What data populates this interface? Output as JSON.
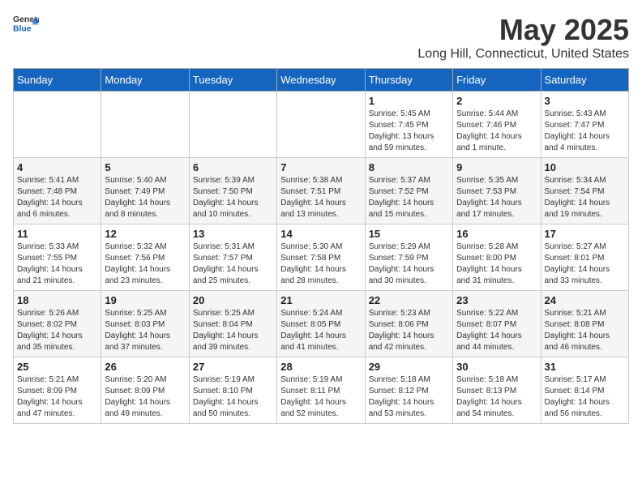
{
  "header": {
    "logo_general": "General",
    "logo_blue": "Blue",
    "title": "May 2025",
    "subtitle": "Long Hill, Connecticut, United States"
  },
  "days_of_week": [
    "Sunday",
    "Monday",
    "Tuesday",
    "Wednesday",
    "Thursday",
    "Friday",
    "Saturday"
  ],
  "weeks": [
    {
      "row_style": "row-odd",
      "days": [
        {
          "number": "",
          "info": ""
        },
        {
          "number": "",
          "info": ""
        },
        {
          "number": "",
          "info": ""
        },
        {
          "number": "",
          "info": ""
        },
        {
          "number": "1",
          "info": "Sunrise: 5:45 AM\nSunset: 7:45 PM\nDaylight: 13 hours\nand 59 minutes."
        },
        {
          "number": "2",
          "info": "Sunrise: 5:44 AM\nSunset: 7:46 PM\nDaylight: 14 hours\nand 1 minute."
        },
        {
          "number": "3",
          "info": "Sunrise: 5:43 AM\nSunset: 7:47 PM\nDaylight: 14 hours\nand 4 minutes."
        }
      ]
    },
    {
      "row_style": "row-even",
      "days": [
        {
          "number": "4",
          "info": "Sunrise: 5:41 AM\nSunset: 7:48 PM\nDaylight: 14 hours\nand 6 minutes."
        },
        {
          "number": "5",
          "info": "Sunrise: 5:40 AM\nSunset: 7:49 PM\nDaylight: 14 hours\nand 8 minutes."
        },
        {
          "number": "6",
          "info": "Sunrise: 5:39 AM\nSunset: 7:50 PM\nDaylight: 14 hours\nand 10 minutes."
        },
        {
          "number": "7",
          "info": "Sunrise: 5:38 AM\nSunset: 7:51 PM\nDaylight: 14 hours\nand 13 minutes."
        },
        {
          "number": "8",
          "info": "Sunrise: 5:37 AM\nSunset: 7:52 PM\nDaylight: 14 hours\nand 15 minutes."
        },
        {
          "number": "9",
          "info": "Sunrise: 5:35 AM\nSunset: 7:53 PM\nDaylight: 14 hours\nand 17 minutes."
        },
        {
          "number": "10",
          "info": "Sunrise: 5:34 AM\nSunset: 7:54 PM\nDaylight: 14 hours\nand 19 minutes."
        }
      ]
    },
    {
      "row_style": "row-odd",
      "days": [
        {
          "number": "11",
          "info": "Sunrise: 5:33 AM\nSunset: 7:55 PM\nDaylight: 14 hours\nand 21 minutes."
        },
        {
          "number": "12",
          "info": "Sunrise: 5:32 AM\nSunset: 7:56 PM\nDaylight: 14 hours\nand 23 minutes."
        },
        {
          "number": "13",
          "info": "Sunrise: 5:31 AM\nSunset: 7:57 PM\nDaylight: 14 hours\nand 25 minutes."
        },
        {
          "number": "14",
          "info": "Sunrise: 5:30 AM\nSunset: 7:58 PM\nDaylight: 14 hours\nand 28 minutes."
        },
        {
          "number": "15",
          "info": "Sunrise: 5:29 AM\nSunset: 7:59 PM\nDaylight: 14 hours\nand 30 minutes."
        },
        {
          "number": "16",
          "info": "Sunrise: 5:28 AM\nSunset: 8:00 PM\nDaylight: 14 hours\nand 31 minutes."
        },
        {
          "number": "17",
          "info": "Sunrise: 5:27 AM\nSunset: 8:01 PM\nDaylight: 14 hours\nand 33 minutes."
        }
      ]
    },
    {
      "row_style": "row-even",
      "days": [
        {
          "number": "18",
          "info": "Sunrise: 5:26 AM\nSunset: 8:02 PM\nDaylight: 14 hours\nand 35 minutes."
        },
        {
          "number": "19",
          "info": "Sunrise: 5:25 AM\nSunset: 8:03 PM\nDaylight: 14 hours\nand 37 minutes."
        },
        {
          "number": "20",
          "info": "Sunrise: 5:25 AM\nSunset: 8:04 PM\nDaylight: 14 hours\nand 39 minutes."
        },
        {
          "number": "21",
          "info": "Sunrise: 5:24 AM\nSunset: 8:05 PM\nDaylight: 14 hours\nand 41 minutes."
        },
        {
          "number": "22",
          "info": "Sunrise: 5:23 AM\nSunset: 8:06 PM\nDaylight: 14 hours\nand 42 minutes."
        },
        {
          "number": "23",
          "info": "Sunrise: 5:22 AM\nSunset: 8:07 PM\nDaylight: 14 hours\nand 44 minutes."
        },
        {
          "number": "24",
          "info": "Sunrise: 5:21 AM\nSunset: 8:08 PM\nDaylight: 14 hours\nand 46 minutes."
        }
      ]
    },
    {
      "row_style": "row-odd",
      "days": [
        {
          "number": "25",
          "info": "Sunrise: 5:21 AM\nSunset: 8:09 PM\nDaylight: 14 hours\nand 47 minutes."
        },
        {
          "number": "26",
          "info": "Sunrise: 5:20 AM\nSunset: 8:09 PM\nDaylight: 14 hours\nand 49 minutes."
        },
        {
          "number": "27",
          "info": "Sunrise: 5:19 AM\nSunset: 8:10 PM\nDaylight: 14 hours\nand 50 minutes."
        },
        {
          "number": "28",
          "info": "Sunrise: 5:19 AM\nSunset: 8:11 PM\nDaylight: 14 hours\nand 52 minutes."
        },
        {
          "number": "29",
          "info": "Sunrise: 5:18 AM\nSunset: 8:12 PM\nDaylight: 14 hours\nand 53 minutes."
        },
        {
          "number": "30",
          "info": "Sunrise: 5:18 AM\nSunset: 8:13 PM\nDaylight: 14 hours\nand 54 minutes."
        },
        {
          "number": "31",
          "info": "Sunrise: 5:17 AM\nSunset: 8:14 PM\nDaylight: 14 hours\nand 56 minutes."
        }
      ]
    }
  ]
}
